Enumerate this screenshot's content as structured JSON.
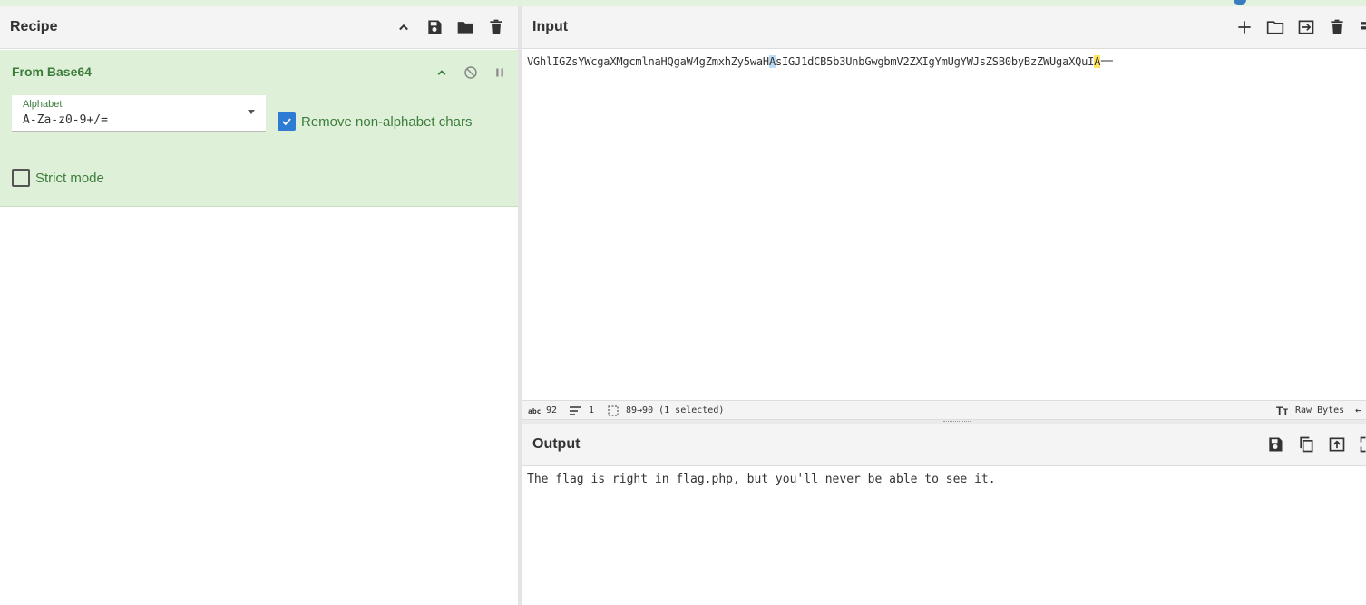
{
  "recipe": {
    "title": "Recipe",
    "header_icons": [
      "chevron-up-icon",
      "save-icon",
      "folder-icon",
      "trash-icon"
    ],
    "operation": {
      "title": "From Base64",
      "alphabet_label": "Alphabet",
      "alphabet_value": "A-Za-z0-9+/=",
      "remove_non_alphabet_label": "Remove non-alphabet chars",
      "remove_non_alphabet_checked": true,
      "strict_mode_label": "Strict mode",
      "strict_mode_checked": false
    }
  },
  "input": {
    "title": "Input",
    "text_part1": "VGhlIGZsYWcgaXMgcmlnaHQgaW4gZmxhZy5waH",
    "text_hl1": "A",
    "text_part2": "sIGJ1dCB5b3UnbGwgbmV2ZXIgYmUgYWJsZSB0byBzZWUgaXQuI",
    "text_hl2": "A",
    "text_part3": "=="
  },
  "status": {
    "length_label": "abc",
    "length": "92",
    "lines": "1",
    "selection": "89→90 (1 selected)",
    "encoding": "Raw Bytes"
  },
  "output": {
    "title": "Output",
    "text": "The flag is right in flag.php, but you'll never be able to see it."
  },
  "colors": {
    "operation_bg": "#dff0d8",
    "operation_text": "#3c7d3c",
    "checkbox_checked": "#2d7bd3",
    "highlight_blue": "#bcdcf7",
    "highlight_yellow": "#ffe55c"
  }
}
